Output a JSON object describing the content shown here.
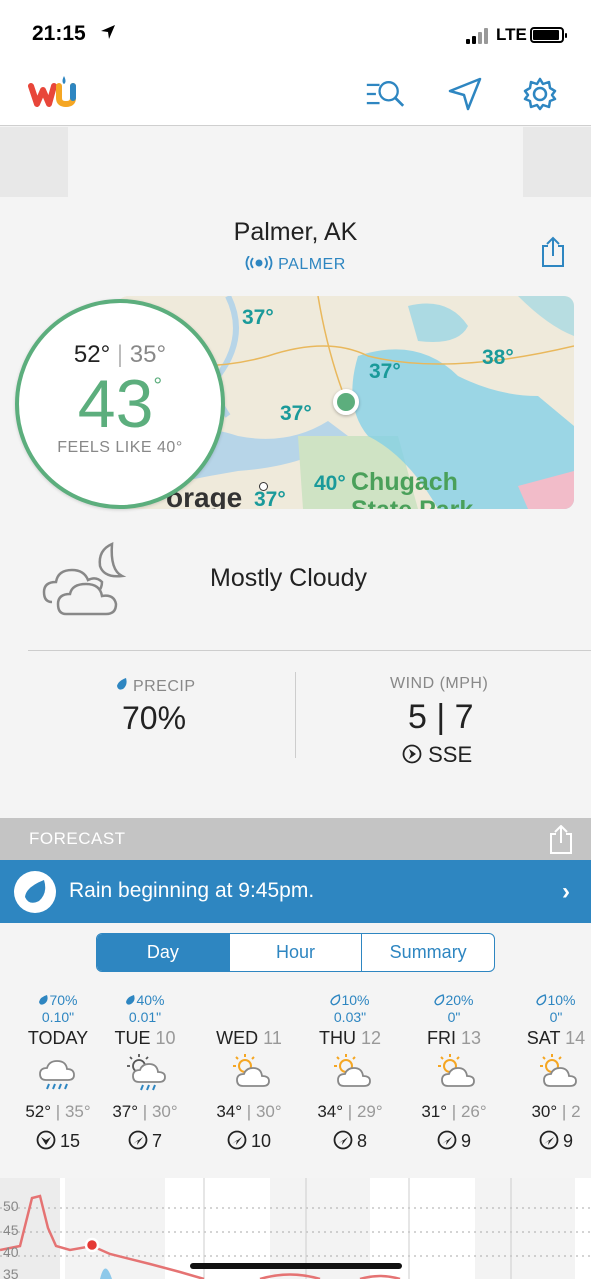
{
  "status_bar": {
    "time": "21:15",
    "network": "LTE"
  },
  "header": {
    "logo": "wu",
    "icons": [
      "search-list-icon",
      "location-arrow-icon",
      "gear-icon"
    ]
  },
  "location": {
    "name": "Palmer, AK",
    "station": "PALMER"
  },
  "map": {
    "labels": [
      "37°",
      "37°",
      "38°",
      "37°",
      "40°",
      "37°"
    ],
    "place_labels": [
      "Chugach",
      "State Park",
      "orage"
    ]
  },
  "current": {
    "high": "52°",
    "low": "35°",
    "temp": "43",
    "degree": "°",
    "feels_like": "FEELS LIKE 40°",
    "condition": "Mostly Cloudy",
    "condition_icon": "cloud-moon-icon"
  },
  "stats": {
    "precip_label": "PRECIP",
    "precip_value": "70%",
    "wind_label": "WIND (MPH)",
    "wind_value": "5 | 7",
    "wind_dir": "SSE"
  },
  "forecast": {
    "title": "FORECAST",
    "rain_banner": "Rain beginning at 9:45pm.",
    "tabs": [
      {
        "label": "Day",
        "active": true
      },
      {
        "label": "Hour",
        "active": false
      },
      {
        "label": "Summary",
        "active": false
      }
    ],
    "days": [
      {
        "name": "TODAY",
        "num": "",
        "precip": "70%",
        "amount": "0.10\"",
        "high": "52°",
        "low": "35°",
        "wind": "15",
        "icon": "rain-cloud-icon",
        "precip_icon": "drop-filled"
      },
      {
        "name": "TUE",
        "num": "10",
        "precip": "40%",
        "amount": "0.01\"",
        "high": "37°",
        "low": "30°",
        "wind": "7",
        "icon": "sun-cloud-rain-icon",
        "precip_icon": "drop-filled"
      },
      {
        "name": "WED",
        "num": "11",
        "precip": "",
        "amount": "",
        "high": "34°",
        "low": "30°",
        "wind": "10",
        "icon": "partly-sunny-icon",
        "precip_icon": ""
      },
      {
        "name": "THU",
        "num": "12",
        "precip": "10%",
        "amount": "0.03\"",
        "high": "34°",
        "low": "29°",
        "wind": "8",
        "icon": "partly-sunny-icon",
        "precip_icon": "drop-outline"
      },
      {
        "name": "FRI",
        "num": "13",
        "precip": "20%",
        "amount": "0\"",
        "high": "31°",
        "low": "26°",
        "wind": "9",
        "icon": "partly-sunny-icon",
        "precip_icon": "drop-outline"
      },
      {
        "name": "SAT",
        "num": "14",
        "precip": "10%",
        "amount": "0\"",
        "high": "30°",
        "low": "2",
        "wind": "9",
        "icon": "partly-sunny-icon",
        "precip_icon": "drop-outline"
      }
    ],
    "graph_labels": [
      "50",
      "45",
      "40",
      "35"
    ]
  }
}
